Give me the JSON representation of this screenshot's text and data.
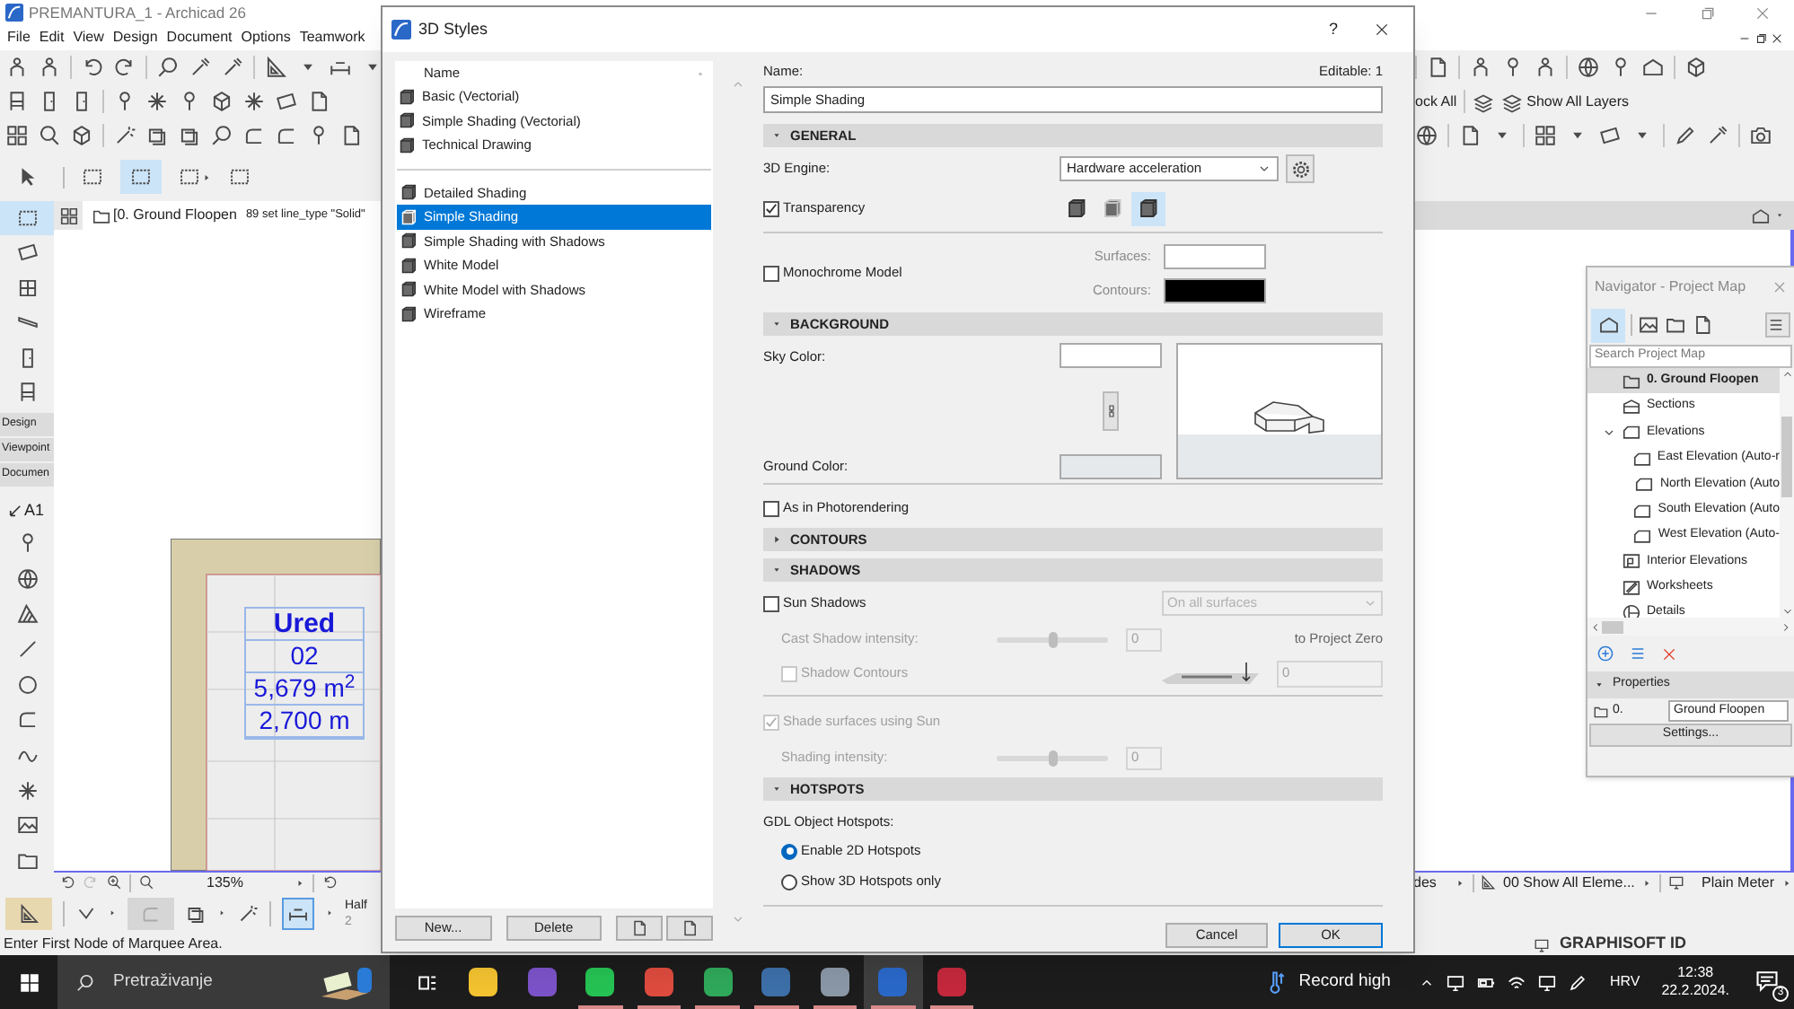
{
  "app": {
    "title": "PREMANTURA_1 - Archicad 26",
    "menu": [
      "File",
      "Edit",
      "View",
      "Design",
      "Document",
      "Options",
      "Teamwork"
    ],
    "layer_buttons": [
      "ock All",
      "Show All Layers"
    ],
    "view_tab": "[0. Ground Floopen",
    "view_note": "89 set line_type \"Solid\"",
    "palette_tabs": [
      "Design",
      "Viewpoint",
      "Documen"
    ],
    "label_tool": "A1",
    "zone_stamp": [
      "Ured",
      "02",
      "5,679 m$^{2}$",
      "2,700 m"
    ],
    "zoom": "135%",
    "bottom_items": [
      "des",
      "00 Show All Eleme...",
      "Plain Meter"
    ],
    "layer_combo": {
      "label": "Half",
      "value": "2"
    },
    "status": "Enter First Node of Marquee Area.",
    "account": "GRAPHISOFT ID"
  },
  "dialog": {
    "title": "3D Styles",
    "help": "?",
    "list_header": "Name",
    "style_groups": [
      [
        {
          "label": "Basic (Vectorial)",
          "selected": false
        },
        {
          "label": "Simple Shading (Vectorial)",
          "selected": false
        },
        {
          "label": "Technical Drawing",
          "selected": false
        }
      ],
      [
        {
          "label": "Detailed Shading",
          "selected": false
        },
        {
          "label": "Simple Shading",
          "selected": true
        },
        {
          "label": "Simple Shading with Shadows",
          "selected": false
        },
        {
          "label": "White Model",
          "selected": false
        },
        {
          "label": "White Model with Shadows",
          "selected": false
        },
        {
          "label": "Wireframe",
          "selected": false
        }
      ]
    ],
    "list_buttons": [
      "New...",
      "Delete"
    ],
    "name_label": "Name:",
    "editable": "Editable: 1",
    "name_value": "Simple Shading",
    "sections": [
      {
        "kind": "general",
        "title": "GENERAL",
        "expanded": true,
        "engine_label": "3D Engine:",
        "engine_value": "Hardware acceleration",
        "transparency": {
          "label": "Transparency",
          "checked": true
        },
        "modes": [
          {
            "selected": false,
            "disabled": false
          },
          {
            "selected": false,
            "disabled": true
          },
          {
            "selected": true,
            "disabled": false
          }
        ],
        "monochrome": {
          "label": "Monochrome Model",
          "checked": false
        },
        "surfaces_label": "Surfaces:",
        "contours_label": "Contours:"
      },
      {
        "kind": "background",
        "title": "BACKGROUND",
        "expanded": true,
        "sky_label": "Sky Color:",
        "ground_label": "Ground Color:",
        "photorendering": {
          "label": "As in Photorendering",
          "checked": false
        }
      },
      {
        "kind": "contours",
        "title": "CONTOURS",
        "expanded": false
      },
      {
        "kind": "shadows",
        "title": "SHADOWS",
        "expanded": true,
        "sun_shadows": {
          "label": "Sun Shadows",
          "checked": false
        },
        "surfaces_select": {
          "value": "On all surfaces",
          "disabled": true
        },
        "cast": {
          "label": "Cast Shadow intensity:",
          "level": 0.5,
          "value": "0",
          "disabled": true
        },
        "project_zero": "to Project Zero",
        "shadow_contours": {
          "label": "Shadow Contours",
          "checked": false,
          "disabled": true
        },
        "elevation_value": "0",
        "shade_sun": {
          "label": "Shade surfaces using Sun",
          "checked": true,
          "disabled": true
        },
        "shading": {
          "label": "Shading intensity:",
          "level": 0.5,
          "value": "0",
          "disabled": true
        }
      },
      {
        "kind": "hotspots",
        "title": "HOTSPOTS",
        "expanded": true,
        "gdl_label": "GDL Object Hotspots:",
        "options": [
          {
            "label": "Enable 2D Hotspots",
            "selected": true
          },
          {
            "label": "Show 3D Hotspots only",
            "selected": false
          }
        ]
      }
    ],
    "cancel": "Cancel",
    "ok": "OK"
  },
  "navigator": {
    "title": "Navigator - Project Map",
    "search_placeholder": "Search Project Map",
    "tree": [
      {
        "kind": "story",
        "label": "0. Ground Floopen",
        "selected": true
      },
      {
        "kind": "section",
        "label": "Sections",
        "selected": false
      },
      {
        "kind": "elevation",
        "label": "Elevations",
        "selected": false,
        "expanded": true,
        "children": [
          {
            "kind": "elevation",
            "label": "East Elevation (Auto-r",
            "selected": false
          },
          {
            "kind": "elevation",
            "label": "North Elevation (Auto",
            "selected": false
          },
          {
            "kind": "elevation",
            "label": "South Elevation (Auto",
            "selected": false
          },
          {
            "kind": "elevation",
            "label": "West Elevation (Auto-",
            "selected": false
          }
        ]
      },
      {
        "kind": "interior",
        "label": "Interior Elevations",
        "selected": false
      },
      {
        "kind": "worksheet",
        "label": "Worksheets",
        "selected": false
      },
      {
        "kind": "detail",
        "label": "Details",
        "selected": false
      }
    ],
    "properties_title": "Properties",
    "story_number": "0.",
    "story_name": "Ground Floopen",
    "settings": "Settings..."
  },
  "taskbar": {
    "search_placeholder": "Pretraživanje",
    "apps": [
      {
        "color": "#f2c230",
        "selected": false,
        "running": false
      },
      {
        "color": "#7b53c8",
        "selected": false,
        "running": false
      },
      {
        "color": "#25c253",
        "selected": false,
        "running": true
      },
      {
        "color": "#dd4b3e",
        "selected": false,
        "running": true
      },
      {
        "color": "#2fa85a",
        "selected": false,
        "running": true
      },
      {
        "color": "#3d6fa8",
        "selected": false,
        "running": true
      },
      {
        "color": "#8a97a6",
        "selected": false,
        "running": true
      },
      {
        "color": "#2a68c8",
        "selected": true,
        "running": true
      },
      {
        "color": "#c4283c",
        "selected": false,
        "running": true
      }
    ],
    "weather": "Record high",
    "language": "HRV",
    "time": "12:38",
    "date": "22.2.2024.",
    "notifications": "3"
  }
}
